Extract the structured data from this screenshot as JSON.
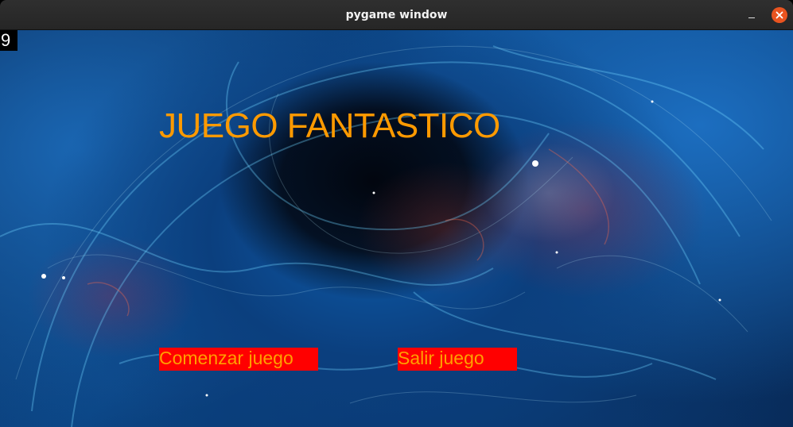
{
  "window": {
    "title": "pygame window",
    "close_color": "#e95420"
  },
  "hud": {
    "counter": "9"
  },
  "menu": {
    "title": "JUEGO FANTASTICO",
    "title_color": "#ff9a00",
    "buttons": [
      {
        "label": "Comenzar juego"
      },
      {
        "label": "Salir juego"
      }
    ],
    "button_bg": "#ff0000",
    "button_text_color": "#ffa000"
  },
  "background": {
    "description_icon": "galaxy-nebula-background"
  }
}
